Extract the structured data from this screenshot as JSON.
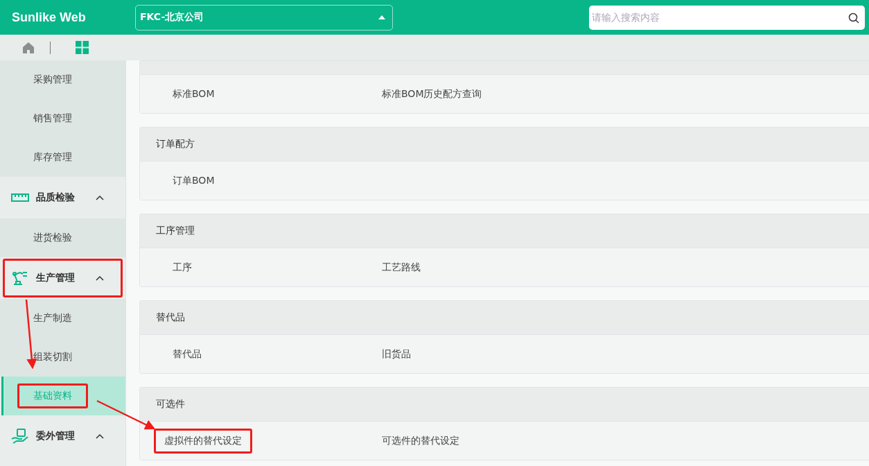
{
  "header": {
    "brand": "Sunlike Web",
    "company_select": {
      "value": "FKC-北京公司"
    },
    "search": {
      "placeholder": "请输入搜索内容"
    }
  },
  "sidebar": {
    "items": [
      {
        "kind": "sub",
        "label": "采购管理",
        "selected": false,
        "highlighted": false
      },
      {
        "kind": "sub",
        "label": "销售管理",
        "selected": false,
        "highlighted": false
      },
      {
        "kind": "sub",
        "label": "库存管理",
        "selected": false,
        "highlighted": false
      },
      {
        "kind": "group",
        "label": "品质检验",
        "expanded": true,
        "highlighted": false,
        "children": [
          {
            "label": "进货检验",
            "selected": false,
            "highlighted": false
          }
        ]
      },
      {
        "kind": "group",
        "label": "生产管理",
        "expanded": true,
        "highlighted": true,
        "children": [
          {
            "label": "生产制造",
            "selected": false,
            "highlighted": false
          },
          {
            "label": "组装切割",
            "selected": false,
            "highlighted": false
          },
          {
            "label": "基础资料",
            "selected": true,
            "highlighted": true
          }
        ]
      },
      {
        "kind": "group",
        "label": "委外管理",
        "expanded": true,
        "highlighted": false
      }
    ]
  },
  "sections": [
    {
      "links": [
        {
          "label": "标准BOM",
          "highlighted": false
        },
        {
          "label": "标准BOM历史配方查询",
          "highlighted": false
        }
      ]
    },
    {
      "title": "订单配方",
      "links": [
        {
          "label": "订单BOM",
          "highlighted": false
        }
      ]
    },
    {
      "title": "工序管理",
      "links": [
        {
          "label": "工序",
          "highlighted": false
        },
        {
          "label": "工艺路线",
          "highlighted": false
        }
      ]
    },
    {
      "title": "替代品",
      "links": [
        {
          "label": "替代品",
          "highlighted": false
        },
        {
          "label": "旧货品",
          "highlighted": false
        }
      ]
    },
    {
      "title": "可选件",
      "links": [
        {
          "label": "虚拟件的替代设定",
          "highlighted": true
        },
        {
          "label": "可选件的替代设定",
          "highlighted": false
        }
      ]
    }
  ]
}
